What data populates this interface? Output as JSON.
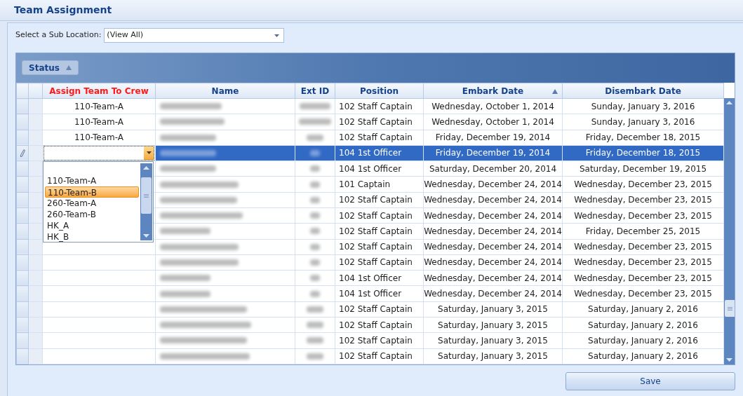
{
  "window": {
    "title": "Team Assignment"
  },
  "sub_location": {
    "label": "Select a Sub Location:",
    "value": "(View All)"
  },
  "group_panel": {
    "label": "Status"
  },
  "columns": [
    {
      "label": "Assign Team To Crew",
      "required": true,
      "sorted": false
    },
    {
      "label": "Name",
      "required": false,
      "sorted": false
    },
    {
      "label": "Ext ID",
      "required": false,
      "sorted": false
    },
    {
      "label": "Position",
      "required": false,
      "sorted": false
    },
    {
      "label": "Embark Date",
      "required": false,
      "sorted": true
    },
    {
      "label": "Disembark Date",
      "required": false,
      "sorted": false
    }
  ],
  "rows": [
    {
      "team": "110-Team-A",
      "position": "102 Staff Captain",
      "embark": "Wednesday, October 1, 2014",
      "disembark": "Sunday, January 3, 2016",
      "selected": false
    },
    {
      "team": "110-Team-A",
      "position": "102 Staff Captain",
      "embark": "Wednesday, October 1, 2014",
      "disembark": "Sunday, January 3, 2016",
      "selected": false
    },
    {
      "team": "110-Team-A",
      "position": "102 Staff Captain",
      "embark": "Friday, December 19, 2014",
      "disembark": "Friday, December 18, 2015",
      "selected": false
    },
    {
      "position": "104 1st Officer",
      "embark": "Friday, December 19, 2014",
      "disembark": "Friday, December 18, 2015",
      "selected": true
    },
    {
      "position": "104 1st Officer",
      "embark": "Saturday, December 20, 2014",
      "disembark": "Saturday, December 19, 2015",
      "selected": false
    },
    {
      "position": "101 Captain",
      "embark": "Wednesday, December 24, 2014",
      "disembark": "Wednesday, December 23, 2015",
      "selected": false
    },
    {
      "position": "102 Staff Captain",
      "embark": "Wednesday, December 24, 2014",
      "disembark": "Wednesday, December 23, 2015",
      "selected": false
    },
    {
      "position": "102 Staff Captain",
      "embark": "Wednesday, December 24, 2014",
      "disembark": "Wednesday, December 23, 2015",
      "selected": false
    },
    {
      "position": "102 Staff Captain",
      "embark": "Wednesday, December 24, 2014",
      "disembark": "Friday, December 25, 2015",
      "selected": false
    },
    {
      "position": "102 Staff Captain",
      "embark": "Wednesday, December 24, 2014",
      "disembark": "Wednesday, December 23, 2015",
      "selected": false
    },
    {
      "position": "102 Staff Captain",
      "embark": "Wednesday, December 24, 2014",
      "disembark": "Wednesday, December 23, 2015",
      "selected": false
    },
    {
      "position": "104 1st Officer",
      "embark": "Wednesday, December 24, 2014",
      "disembark": "Wednesday, December 23, 2015",
      "selected": false
    },
    {
      "position": "104 1st Officer",
      "embark": "Wednesday, December 24, 2014",
      "disembark": "Wednesday, December 23, 2015",
      "selected": false
    },
    {
      "position": "102 Staff Captain",
      "embark": "Saturday, January 3, 2015",
      "disembark": "Saturday, January 2, 2016",
      "selected": false
    },
    {
      "position": "102 Staff Captain",
      "embark": "Saturday, January 3, 2015",
      "disembark": "Saturday, January 2, 2016",
      "selected": false
    },
    {
      "position": "102 Staff Captain",
      "embark": "Saturday, January 3, 2015",
      "disembark": "Saturday, January 2, 2016",
      "selected": false
    },
    {
      "position": "102 Staff Captain",
      "embark": "Saturday, January 3, 2015",
      "disembark": "Saturday, January 2, 2016",
      "selected": false
    }
  ],
  "team_dropdown": {
    "options": [
      {
        "label": "110-Team-A",
        "selected": false
      },
      {
        "label": "110-Team-B",
        "selected": true
      },
      {
        "label": "260-Team-A",
        "selected": false
      },
      {
        "label": "260-Team-B",
        "selected": false
      },
      {
        "label": "HK_A",
        "selected": false
      },
      {
        "label": "HK_B",
        "selected": false
      }
    ]
  },
  "buttons": [
    {
      "label": "Save"
    }
  ]
}
